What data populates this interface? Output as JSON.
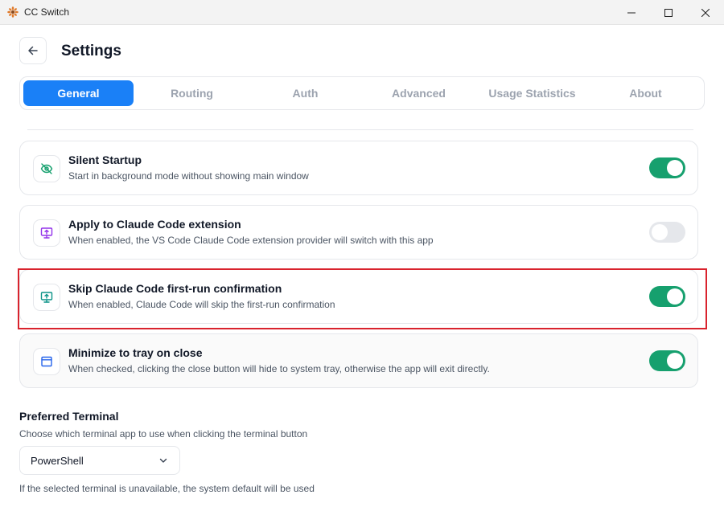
{
  "window": {
    "title": "CC Switch",
    "icon": "sunflower-icon",
    "controls": [
      "minimize-icon",
      "maximize-icon",
      "close-icon"
    ]
  },
  "header": {
    "title": "Settings",
    "back_icon": "arrow-left-icon"
  },
  "tabs": [
    {
      "label": "General",
      "active": true
    },
    {
      "label": "Routing",
      "active": false
    },
    {
      "label": "Auth",
      "active": false
    },
    {
      "label": "Advanced",
      "active": false
    },
    {
      "label": "Usage Statistics",
      "active": false
    },
    {
      "label": "About",
      "active": false
    }
  ],
  "settings": [
    {
      "title": "Silent Startup",
      "description": "Start in background mode without showing main window",
      "icon": "eye-off-icon",
      "icon_color": "#16a06e",
      "enabled": true
    },
    {
      "title": "Apply to Claude Code extension",
      "description": "When enabled, the VS Code Claude Code extension provider will switch with this app",
      "icon": "monitor-upload-icon",
      "icon_color": "#9333ea",
      "enabled": false
    },
    {
      "title": "Skip Claude Code first-run confirmation",
      "description": "When enabled, Claude Code will skip the first-run confirmation",
      "icon": "monitor-upload-icon",
      "icon_color": "#0d9488",
      "enabled": true,
      "highlighted": true
    },
    {
      "title": "Minimize to tray on close",
      "description": "When checked, clicking the close button will hide to system tray, otherwise the app will exit directly.",
      "icon": "window-icon",
      "icon_color": "#2563eb",
      "enabled": true
    }
  ],
  "terminal": {
    "title": "Preferred Terminal",
    "description": "Choose which terminal app to use when clicking the terminal button",
    "selected": "PowerShell",
    "note": "If the selected terminal is unavailable, the system default will be used"
  },
  "colors": {
    "accent": "#1a80f7",
    "toggle_on": "#16a06e",
    "highlight_border": "#d9232d"
  }
}
